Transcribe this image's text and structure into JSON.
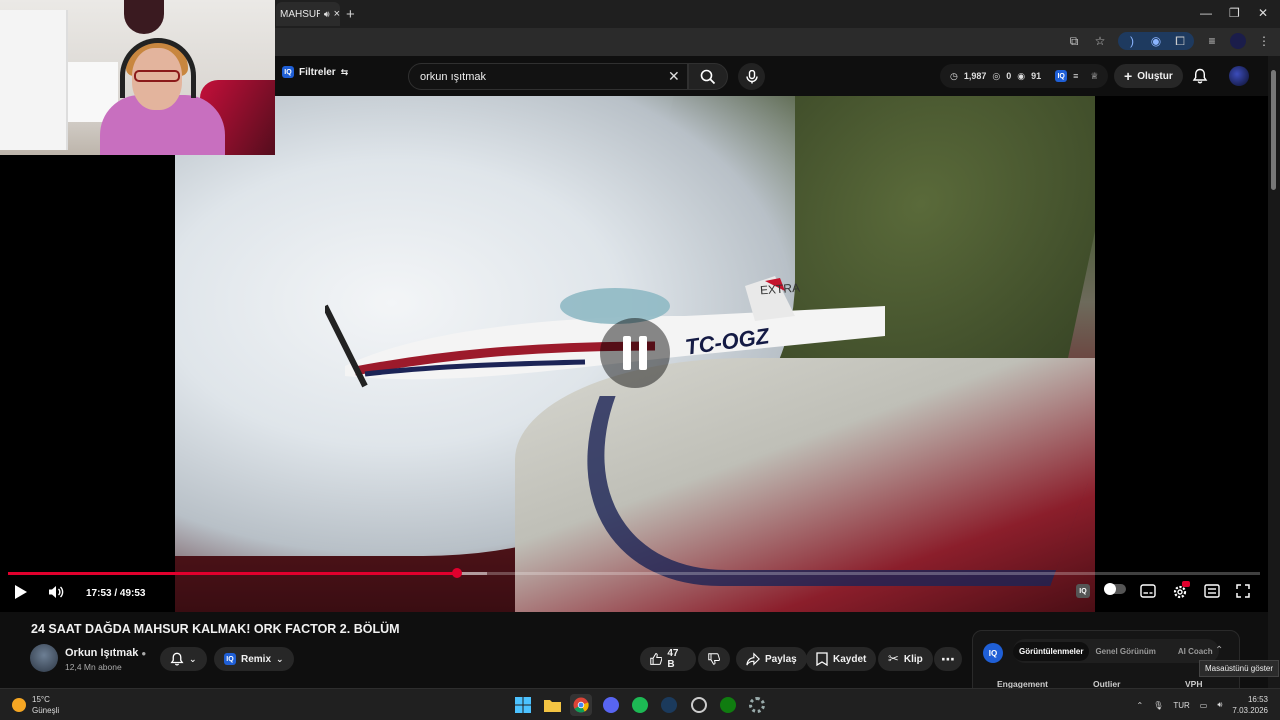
{
  "browser": {
    "tab_title": "MAHSUR",
    "tab_close": "×",
    "new_tab": "+",
    "window_min": "—",
    "window_max": "❐",
    "window_close": "✕"
  },
  "youtube": {
    "filters_label": "Filtreler",
    "search_value": "orkun ışıtmak",
    "stats": {
      "a": "1,987",
      "b": "0",
      "c": "91"
    },
    "create_label": "Oluştur"
  },
  "player": {
    "timecode": "17:53 / 49:53",
    "progress_fraction": 0.3584,
    "buffer_fraction": 0.3826,
    "registration": "TC-OGZ",
    "extra_label": "EXTRA"
  },
  "video": {
    "title": "24 SAAT DAĞDA MAHSUR KALMAK! ORK FACTOR 2. BÖLÜM",
    "channel_name": "Orkun Işıtmak",
    "channel_subs": "12,4 Mn abone",
    "remix_label": "Remix",
    "like_count": "47 B",
    "share_label": "Paylaş",
    "save_label": "Kaydet",
    "clip_label": "Klip"
  },
  "side_panel": {
    "tabs": [
      "Görüntülenmeler",
      "Genel Görünüm",
      "AI Coach"
    ],
    "columns": [
      "Engagement",
      "Outlier",
      "VPH"
    ]
  },
  "tooltip": "Masaüstünü göster",
  "taskbar": {
    "temperature": "15°C",
    "weather": "Güneşli",
    "language": "TUR",
    "time": "16:53",
    "date": "7.03.2026"
  }
}
